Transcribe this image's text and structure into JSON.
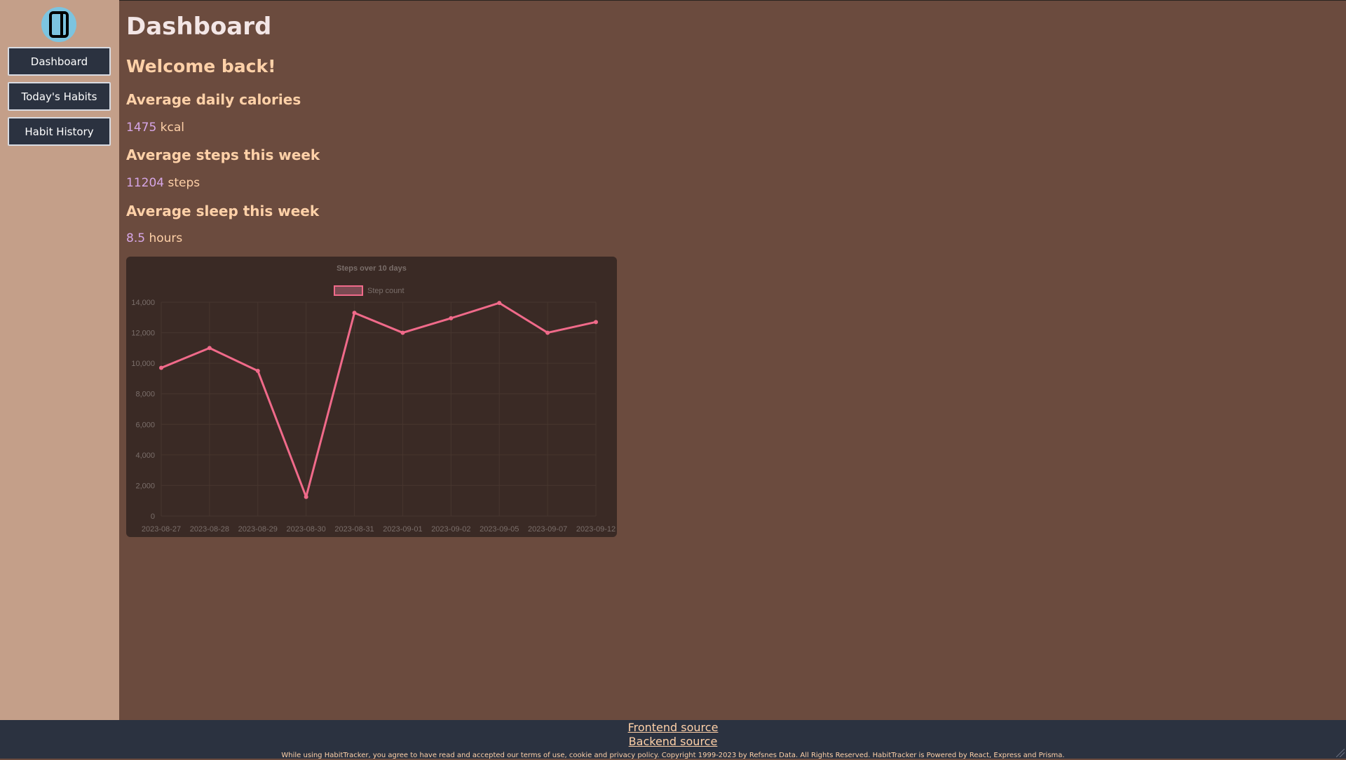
{
  "sidebar": {
    "logo_icon": "book-icon",
    "items": [
      {
        "label": "Dashboard"
      },
      {
        "label": "Today's Habits"
      },
      {
        "label": "Habit History"
      }
    ]
  },
  "main": {
    "title": "Dashboard",
    "welcome": "Welcome back!",
    "stats": [
      {
        "heading": "Average daily calories",
        "value": "1475",
        "unit": "kcal"
      },
      {
        "heading": "Average steps this week",
        "value": "11204",
        "unit": "steps"
      },
      {
        "heading": "Average sleep this week",
        "value": "8.5",
        "unit": "hours"
      }
    ]
  },
  "chart_data": {
    "type": "line",
    "title": "Steps over 10 days",
    "categories": [
      "2023-08-27",
      "2023-08-28",
      "2023-08-29",
      "2023-08-30",
      "2023-08-31",
      "2023-09-01",
      "2023-09-02",
      "2023-09-05",
      "2023-09-07",
      "2023-09-12"
    ],
    "series": [
      {
        "name": "Step count",
        "values": [
          9700,
          11000,
          9500,
          1250,
          13300,
          12000,
          12950,
          13950,
          12000,
          12700
        ]
      }
    ],
    "yticks": [
      "0",
      "2,000",
      "4,000",
      "6,000",
      "8,000",
      "10,000",
      "12,000",
      "14,000"
    ],
    "ylim": [
      0,
      14000
    ],
    "grid": true,
    "legend": "top",
    "colors": {
      "line": "#f06a8a",
      "text": "#7a6e6a",
      "grid": "#47362f"
    }
  },
  "footer": {
    "frontend_link": "Frontend source",
    "backend_link": "Backend source",
    "note": "While using HabitTracker, you agree to have read and accepted our terms of use, cookie and privacy policy. Copyright 1999-2023 by Refsnes Data. All Rights Reserved. HabitTracker is Powered by React, Express and Prisma."
  },
  "colors": {
    "page": "#6b4b3e",
    "sidebar": "#c49f89",
    "button": "#2b3240",
    "heading": "#ffd1a8",
    "number": "#d6a6e6"
  }
}
